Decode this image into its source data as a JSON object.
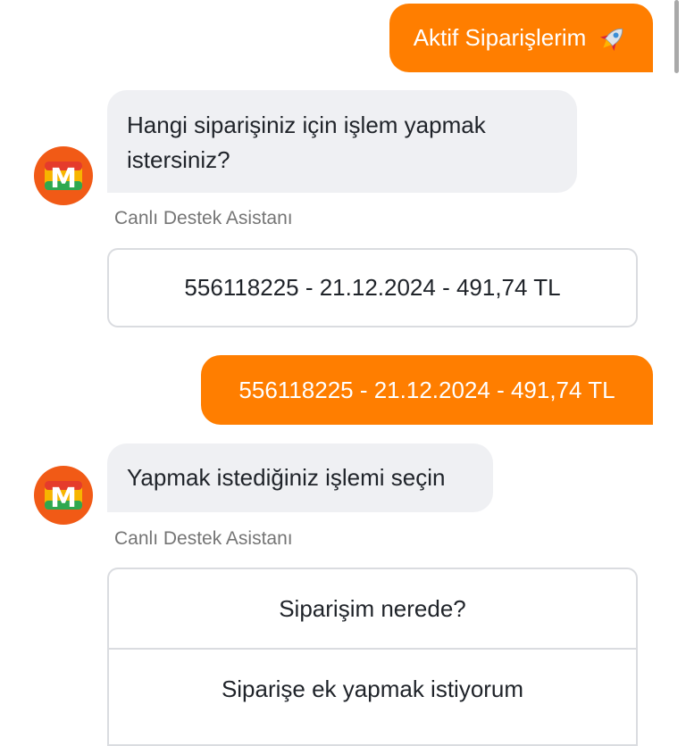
{
  "chat": {
    "user_message_1": "Aktif Siparişlerim",
    "user_message_1_icon": "rocket-icon",
    "bot_message_1": "Hangi siparişiniz için işlem yapmak istersiniz?",
    "sender_1": "Canlı Destek Asistanı",
    "order_option": "556118225 - 21.12.2024 - 491,74 TL",
    "user_message_2": "556118225 - 21.12.2024 - 491,74 TL",
    "bot_message_2": "Yapmak istediğiniz işlemi seçin",
    "sender_2": "Canlı Destek Asistanı",
    "action_options": [
      "Siparişim nerede?",
      "Siparişe ek yapmak istiyorum"
    ]
  },
  "avatar": {
    "logo_letter": "M",
    "icon": "migros-logo-icon"
  },
  "colors": {
    "accent": "#ff7e00",
    "bot_bubble": "#eff0f3",
    "avatar_bg": "#f15a16",
    "border": "#dadce0",
    "sender_text": "#757575"
  }
}
